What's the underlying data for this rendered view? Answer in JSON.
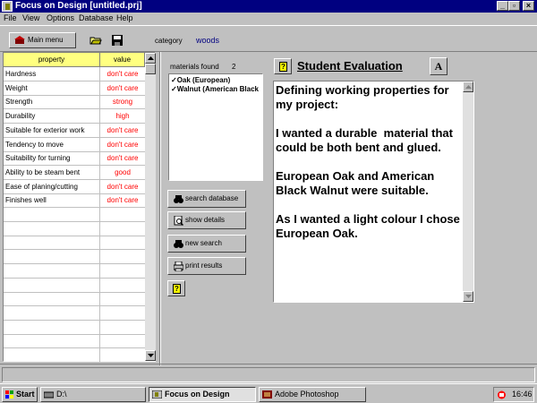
{
  "window": {
    "title": "Focus on Design [untitled.prj]"
  },
  "menubar": [
    "File",
    "View",
    "Options",
    "Database",
    "Help"
  ],
  "toolbar": {
    "main_menu_label": "Main menu",
    "category_label": "category",
    "category_value": "woods"
  },
  "properties": {
    "headers": [
      "property",
      "value"
    ],
    "rows": [
      {
        "property": "Hardness",
        "value": "don't care"
      },
      {
        "property": "Weight",
        "value": "don't care"
      },
      {
        "property": "Strength",
        "value": "strong"
      },
      {
        "property": "Durability",
        "value": "high"
      },
      {
        "property": "Suitable for exterior work",
        "value": "don't care"
      },
      {
        "property": "Tendency to move",
        "value": "don't care"
      },
      {
        "property": "Suitability for turning",
        "value": "don't care"
      },
      {
        "property": "Ability to be steam bent",
        "value": "good"
      },
      {
        "property": "Ease of planing/cutting",
        "value": "don't care"
      },
      {
        "property": "Finishes well",
        "value": "don't care"
      }
    ]
  },
  "materials": {
    "label": "materials found",
    "count": "2",
    "items": [
      "Oak (European)",
      "Walnut (American Black"
    ]
  },
  "actions": {
    "search_database": "search database",
    "show_details": "show details",
    "new_search": "new search",
    "print_results": "print results"
  },
  "evaluation": {
    "title": "Student Evaluation",
    "font_button": "A",
    "text": "Defining working properties for my project:\n\nI wanted a durable  material that could be both bent and glued.\n\nEuropean Oak and American Black Walnut were suitable.\n\nAs I wanted a light colour I chose European Oak."
  },
  "taskbar": {
    "start": "Start",
    "tasks": [
      "D:\\",
      "Focus on Design",
      "Adobe Photoshop"
    ],
    "clock": "16:46"
  },
  "colors": {
    "titlebar": "#000080",
    "value_text": "#ff0000",
    "header_bg": "#ffff80",
    "category": "#000080"
  }
}
